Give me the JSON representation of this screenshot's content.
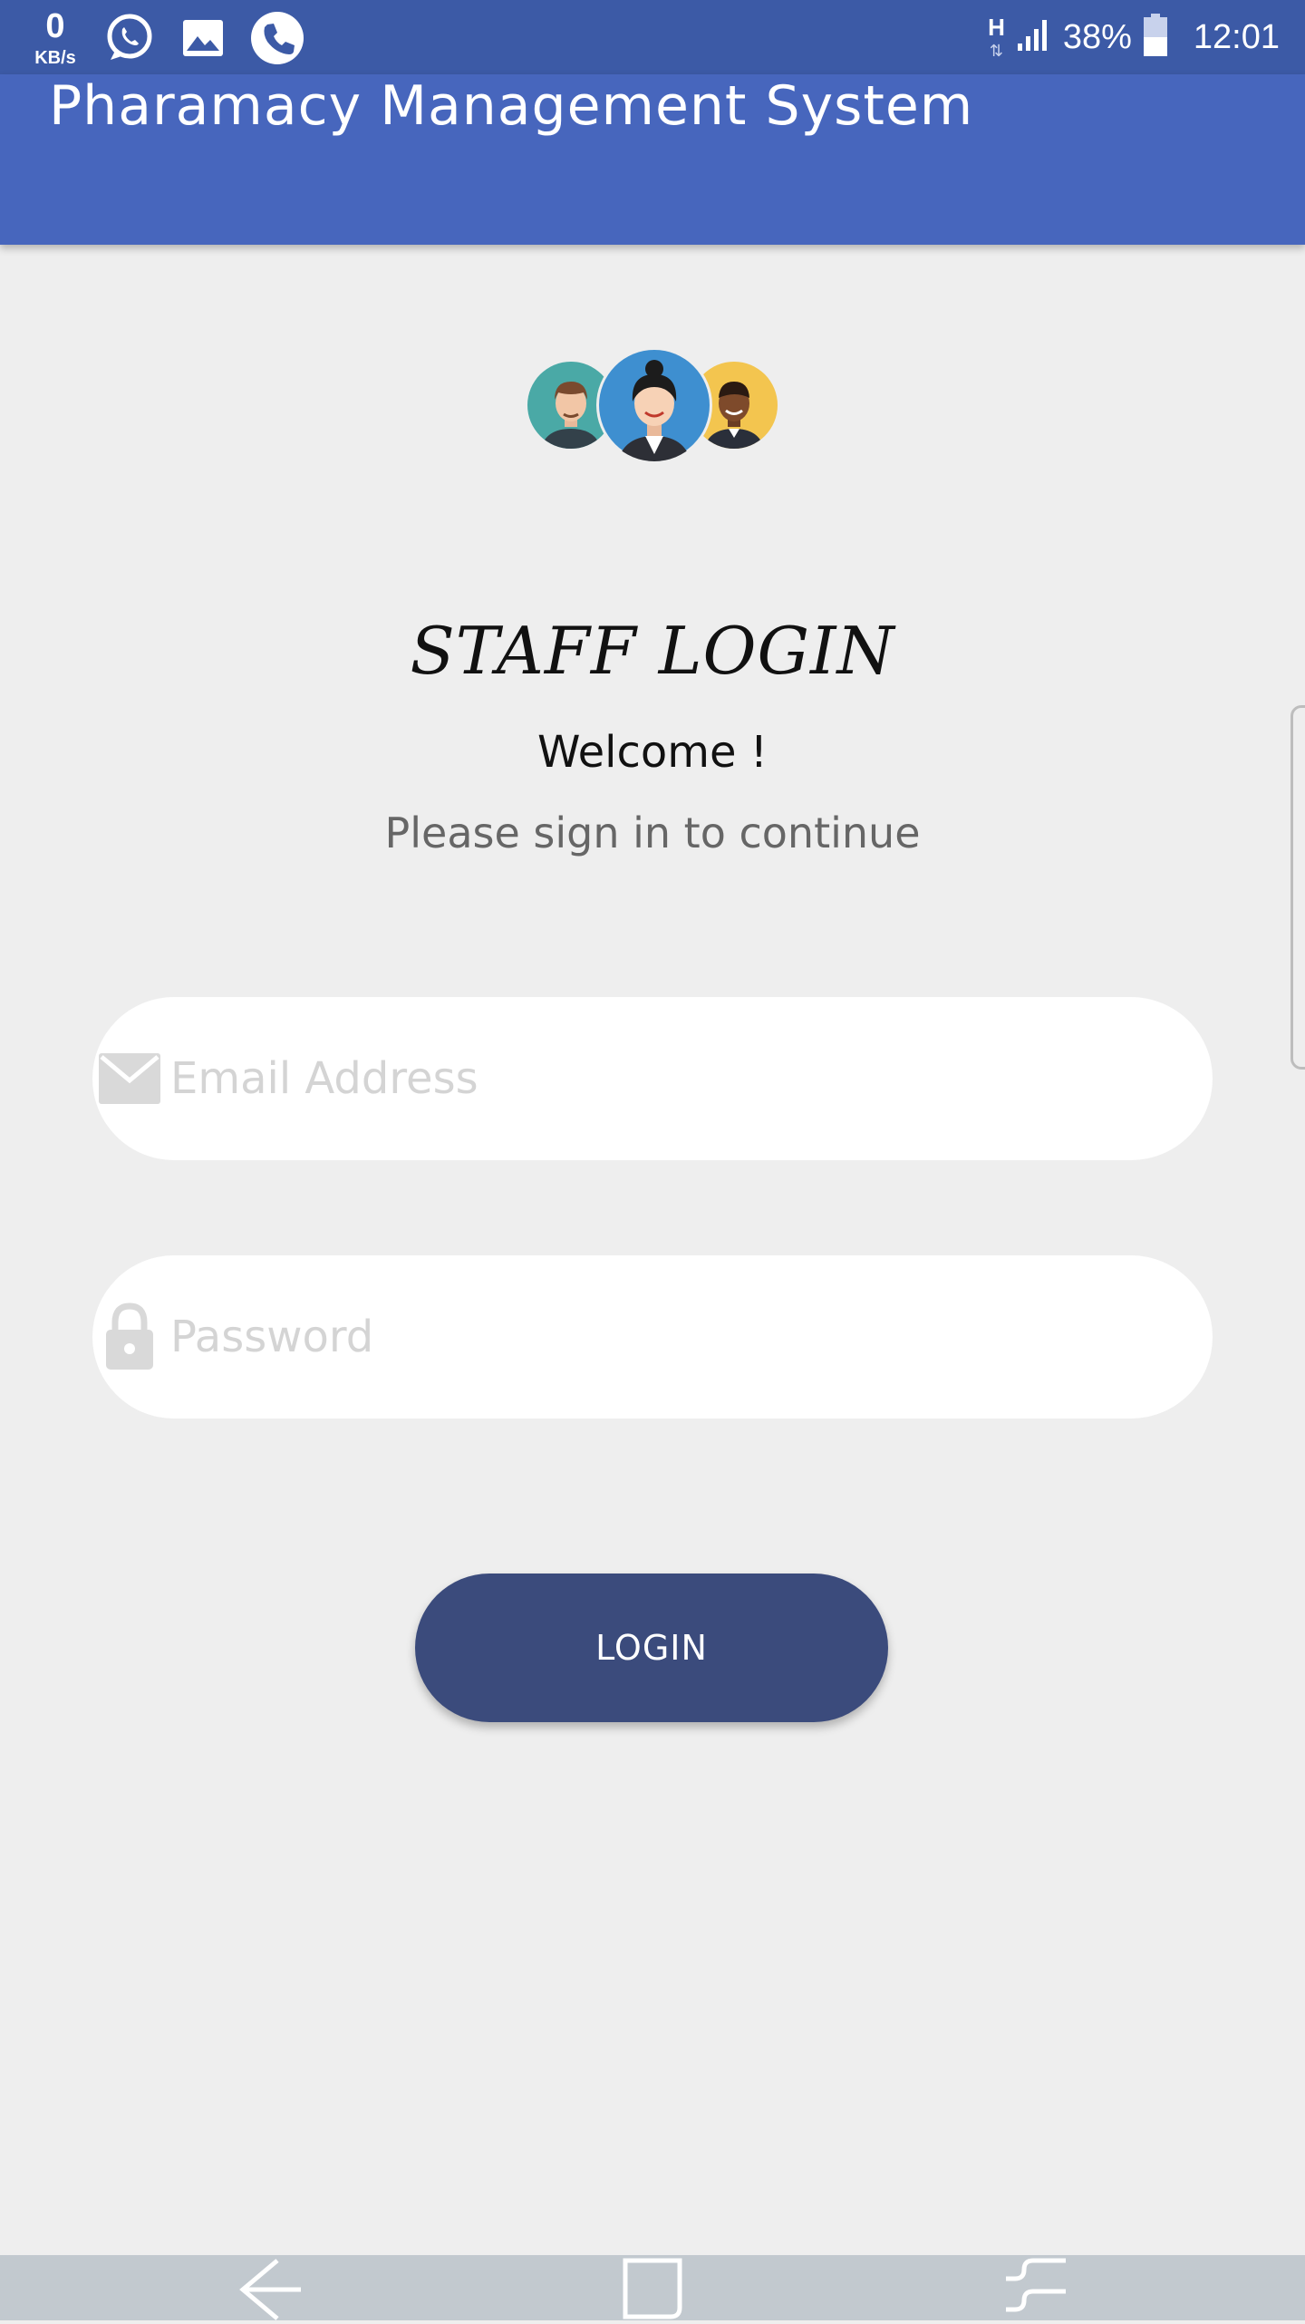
{
  "status_bar": {
    "net_speed_value": "0",
    "net_speed_unit": "KB/s",
    "notifications": [
      "whatsapp-icon",
      "image-icon",
      "phone-icon"
    ],
    "network_type": "H",
    "battery": "38%",
    "time": "12:01"
  },
  "app_bar": {
    "title": "Pharamacy Management System"
  },
  "login": {
    "heading": "STAFF LOGIN",
    "welcome": "Welcome !",
    "subtitle": "Please sign in to continue",
    "email_placeholder": "Email Address",
    "password_placeholder": "Password",
    "button_label": "LOGIN"
  },
  "nav_bar": {
    "buttons": [
      "back-icon",
      "home-icon",
      "recents-icon"
    ]
  },
  "colors": {
    "status_bar": "#3c5aa6",
    "app_bar": "#4766bd",
    "background": "#eeeeee",
    "button": "#3b4b7c",
    "nav_bar": "#c2c9cf"
  }
}
